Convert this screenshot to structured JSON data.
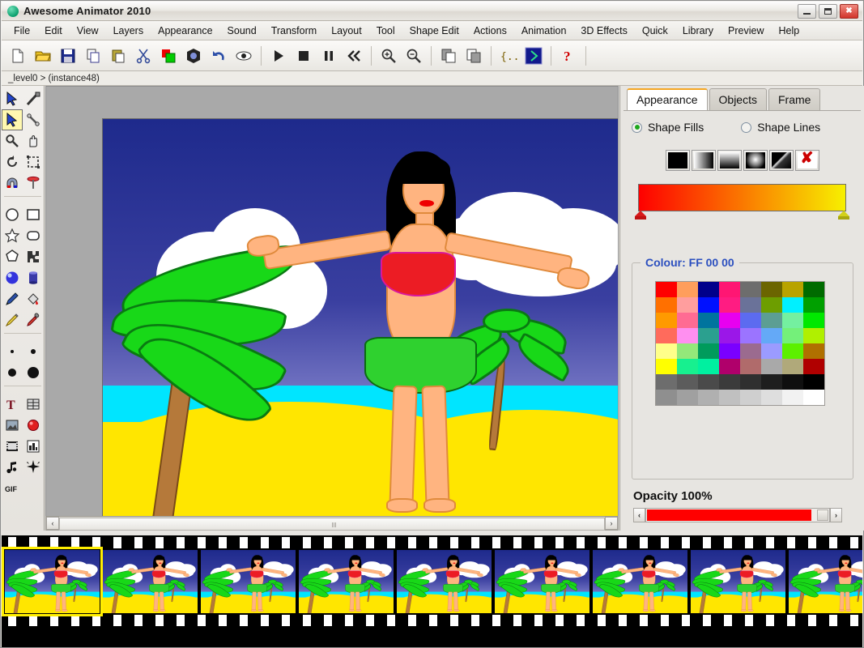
{
  "window": {
    "title": "Awesome Animator 2010",
    "icon": "app-circle-icon",
    "buttons": {
      "minimize": "–",
      "maximize": "□",
      "close": "✕"
    }
  },
  "menubar": {
    "items": [
      {
        "label": "File"
      },
      {
        "label": "Edit"
      },
      {
        "label": "View"
      },
      {
        "label": "Layers"
      },
      {
        "label": "Appearance"
      },
      {
        "label": "Sound"
      },
      {
        "label": "Transform"
      },
      {
        "label": "Layout"
      },
      {
        "label": "Tool"
      },
      {
        "label": "Shape Edit"
      },
      {
        "label": "Actions"
      },
      {
        "label": "Animation"
      },
      {
        "label": "3D Effects"
      },
      {
        "label": "Quick"
      },
      {
        "label": "Library"
      },
      {
        "label": "Preview"
      },
      {
        "label": "Help"
      }
    ]
  },
  "toolbar": {
    "buttons": [
      {
        "name": "new-document-icon",
        "glyph": "□"
      },
      {
        "name": "open-folder-icon",
        "glyph": "▱"
      },
      {
        "name": "save-disk-icon",
        "glyph": "■"
      },
      {
        "name": "copy-icon",
        "glyph": "⧉"
      },
      {
        "name": "paste-icon",
        "glyph": "▤"
      },
      {
        "name": "cut-scissors-icon",
        "glyph": "✂"
      },
      {
        "name": "swap-colors-icon",
        "glyph": "■"
      },
      {
        "name": "morph-shape-icon",
        "glyph": "✦"
      },
      {
        "name": "undo-arrow-icon",
        "glyph": "↶"
      },
      {
        "name": "preview-eye-icon",
        "glyph": "◉"
      },
      {
        "name": "play-icon",
        "glyph": "▶"
      },
      {
        "name": "stop-icon",
        "glyph": "■"
      },
      {
        "name": "pause-icon",
        "glyph": "❙❙"
      },
      {
        "name": "rewind-icon",
        "glyph": "≪"
      },
      {
        "name": "zoom-in-icon",
        "glyph": "⊕"
      },
      {
        "name": "zoom-out-icon",
        "glyph": "⊖"
      },
      {
        "name": "duplicate-front-icon",
        "glyph": "⧉"
      },
      {
        "name": "duplicate-back-icon",
        "glyph": "⧉"
      },
      {
        "name": "actionscript-braces-icon",
        "glyph": "{..}"
      },
      {
        "name": "run-export-icon",
        "glyph": "›"
      },
      {
        "name": "help-question-icon",
        "glyph": "?"
      }
    ]
  },
  "breadcrumb": {
    "text": "_level0 > (instance48)"
  },
  "tools": {
    "groups": [
      {
        "items": [
          {
            "name": "select-arrow-tool",
            "glyph": "↖",
            "selected": false
          },
          {
            "name": "line-edit-tool",
            "glyph": "╱",
            "selected": false
          },
          {
            "name": "subselect-tool",
            "glyph": "↘",
            "selected": true
          },
          {
            "name": "node-edit-tool",
            "glyph": "✂",
            "selected": false
          },
          {
            "name": "magnifier-tool",
            "glyph": "⚲",
            "selected": false
          },
          {
            "name": "hand-pan-tool",
            "glyph": "✋",
            "selected": false
          },
          {
            "name": "rotate-tool",
            "glyph": "↺",
            "selected": false
          },
          {
            "name": "scale-frame-tool",
            "glyph": "⬚",
            "selected": false
          },
          {
            "name": "magnet-snap-tool",
            "glyph": "∩",
            "selected": false
          },
          {
            "name": "pin-tool",
            "glyph": "⚓",
            "selected": false
          }
        ]
      },
      {
        "items": [
          {
            "name": "ellipse-tool",
            "glyph": "○",
            "selected": false
          },
          {
            "name": "rectangle-tool",
            "glyph": "□",
            "selected": false
          },
          {
            "name": "star-tool",
            "glyph": "☆",
            "selected": false
          },
          {
            "name": "rounded-rect-tool",
            "glyph": "▢",
            "selected": false
          },
          {
            "name": "polygon-tool",
            "glyph": "⬠",
            "selected": false
          },
          {
            "name": "puzzle-shape-tool",
            "glyph": "❖",
            "selected": false
          },
          {
            "name": "sphere-3d-tool",
            "glyph": "●",
            "selected": false
          },
          {
            "name": "cylinder-3d-tool",
            "glyph": "▮",
            "selected": false
          },
          {
            "name": "pen-tool",
            "glyph": "✒",
            "selected": false
          },
          {
            "name": "paint-bucket-tool",
            "glyph": "◕",
            "selected": false
          },
          {
            "name": "pencil-tool",
            "glyph": "✎",
            "selected": false
          },
          {
            "name": "eyedropper-tool",
            "glyph": "↗",
            "selected": false
          }
        ]
      },
      {
        "items": [
          {
            "name": "brush-size-xs",
            "glyph": "•",
            "selected": false
          },
          {
            "name": "brush-size-s",
            "glyph": "‣",
            "selected": false
          },
          {
            "name": "brush-size-m",
            "glyph": "●",
            "selected": false
          },
          {
            "name": "brush-size-l",
            "glyph": "⬤",
            "selected": false
          }
        ]
      },
      {
        "items": [
          {
            "name": "text-tool",
            "glyph": "T",
            "selected": false
          },
          {
            "name": "table-tool",
            "glyph": "▦",
            "selected": false
          },
          {
            "name": "image-import-tool",
            "glyph": "⛰",
            "selected": false
          },
          {
            "name": "record-tool",
            "glyph": "●",
            "selected": false
          },
          {
            "name": "film-tool",
            "glyph": "▓",
            "selected": false
          },
          {
            "name": "chart-tool",
            "glyph": "▐",
            "selected": false
          },
          {
            "name": "sound-note-tool",
            "glyph": "♪",
            "selected": false
          },
          {
            "name": "effects-sparkle-tool",
            "glyph": "✸",
            "selected": false
          },
          {
            "name": "gif-export-tool",
            "glyph": "⬛",
            "selected": false
          }
        ]
      }
    ]
  },
  "panel": {
    "tabs": [
      {
        "label": "Appearance",
        "active": true
      },
      {
        "label": "Objects",
        "active": false
      },
      {
        "label": "Frame",
        "active": false
      }
    ],
    "radios": [
      {
        "label": "Shape Fills",
        "selected": true
      },
      {
        "label": "Shape Lines",
        "selected": false
      }
    ],
    "fill_types": [
      {
        "name": "solid-fill-button",
        "type": "solid"
      },
      {
        "name": "linear-gradient-fill-button",
        "type": "linear"
      },
      {
        "name": "vertical-gradient-fill-button",
        "type": "vertical"
      },
      {
        "name": "radial-gradient-fill-button",
        "type": "radial"
      },
      {
        "name": "bitmap-fill-button",
        "type": "bitmap"
      },
      {
        "name": "no-fill-button",
        "type": "none"
      }
    ],
    "gradient": {
      "stops": [
        {
          "position": 0,
          "color": "#FE0000"
        },
        {
          "position": 100,
          "color": "#F7F000"
        }
      ]
    },
    "colour_group_label": "Colour: FF 00 00",
    "selected_colour_hex": "#FF0000",
    "opacity_label": "Opacity 100%",
    "opacity_value": 100,
    "swatch_rows": [
      [
        "#fe0000",
        "#ff9e5c",
        "#00008b",
        "#ff1673",
        "#6d6d6d",
        "#6b6500",
        "#b8a300",
        "#006b00"
      ],
      [
        "#ff7000",
        "#ff9e9e",
        "#0011ff",
        "#ff1c82",
        "#6a7299",
        "#6d9e00",
        "#00f0ff",
        "#00a000"
      ],
      [
        "#ff9a00",
        "#ff6b93",
        "#00749e",
        "#e800f0",
        "#5c6bf0",
        "#5c9e93",
        "#74f0a0",
        "#00e800"
      ],
      [
        "#ff6b5c",
        "#ff8ff0",
        "#2ba08f",
        "#9b17e8",
        "#9b74ff",
        "#64a9f7",
        "#74f07a",
        "#b0f000"
      ],
      [
        "#ffff8a",
        "#93e87a",
        "#009b5c",
        "#7a00ff",
        "#9b6b8f",
        "#9b9bff",
        "#5cf000",
        "#b07000"
      ],
      [
        "#ffff00",
        "#17f08f",
        "#00f0a0",
        "#b0006b",
        "#b06b6b",
        "#a9a9a9",
        "#b0a97a",
        "#b00000"
      ],
      [
        "#6d6d6d",
        "#5c5c5c",
        "#4a4a4a",
        "#3b3b3b",
        "#2f2f2f",
        "#1e1e1e",
        "#0f0f0f",
        "#000000"
      ],
      [
        "#8f8f8f",
        "#a0a0a0",
        "#b0b0b0",
        "#c0c0c0",
        "#cfcfcf",
        "#dedede",
        "#f2f2f2",
        "#ffffff"
      ]
    ]
  },
  "canvas": {
    "artwork_title": "hula-dancer-beach-scene",
    "scrollbar": {
      "left_arrow": "‹",
      "right_arrow": "›"
    }
  },
  "filmstrip": {
    "frame_count": 9,
    "selected_frame": 1
  }
}
